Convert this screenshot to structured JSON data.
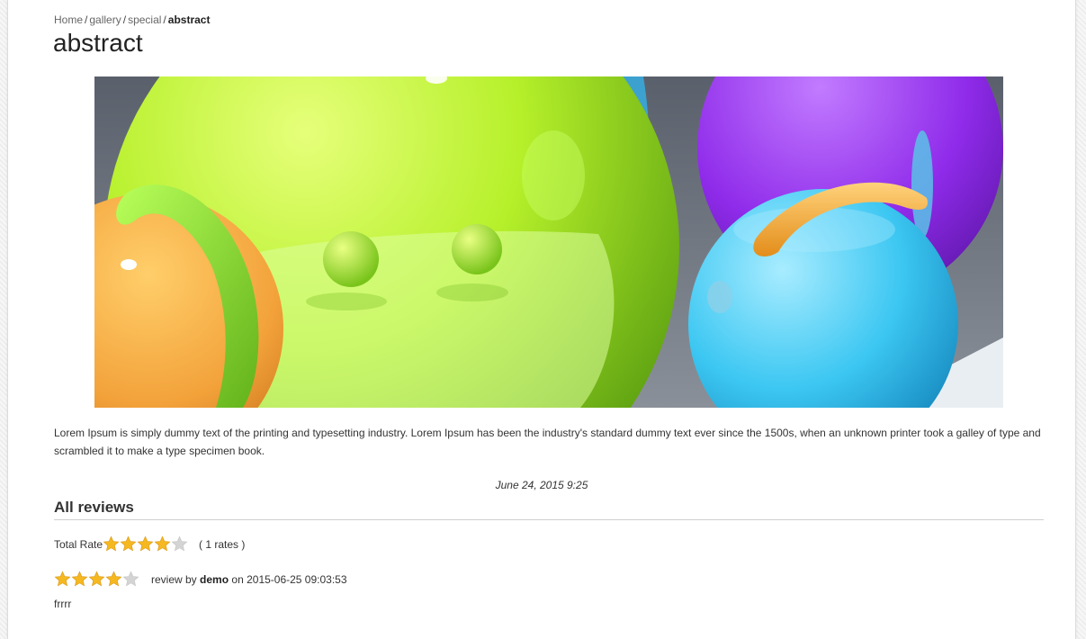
{
  "breadcrumb": {
    "items": [
      "Home",
      "gallery",
      "special"
    ],
    "current": "abstract",
    "separator": "/"
  },
  "page_title": "abstract",
  "description": "Lorem Ipsum is simply dummy text of the printing and typesetting industry. Lorem Ipsum has been the industry's standard dummy text ever since the 1500s, when an unknown printer took a galley of type and scrambled it to make a type specimen book.",
  "date": "June 24, 2015 9:25",
  "reviews": {
    "heading": "All reviews",
    "total_rate_label": "Total Rate",
    "total_rating": 4,
    "max_rating": 5,
    "rates_count_text": "( 1 rates )",
    "items": [
      {
        "rating": 4,
        "prefix": "review by",
        "author": "demo",
        "on_text": "on",
        "datetime": "2015-06-25 09:03:53",
        "text": "frrrr"
      }
    ]
  },
  "colors": {
    "star_filled": "#f5b820",
    "star_empty": "#d4d4d4"
  }
}
